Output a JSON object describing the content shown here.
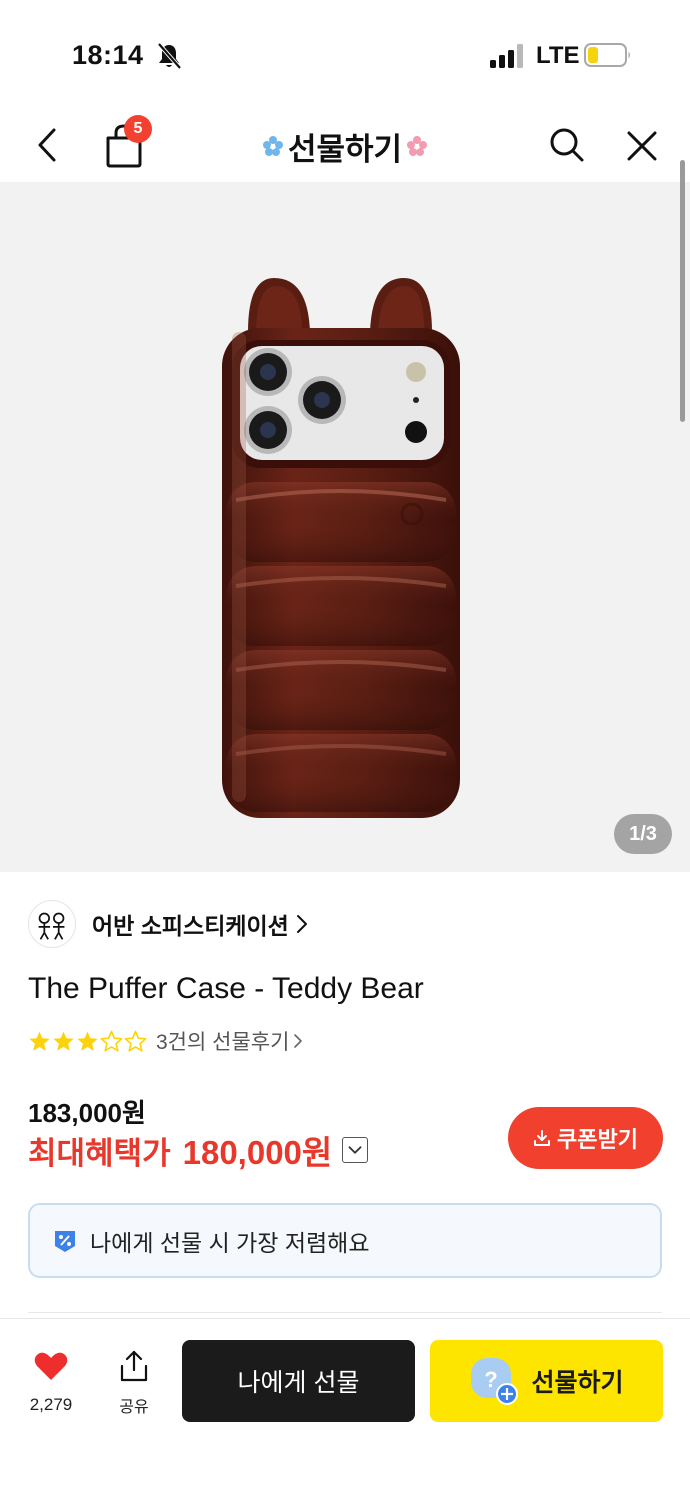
{
  "status_bar": {
    "time": "18:14",
    "network": "LTE"
  },
  "nav": {
    "cart_count": "5",
    "title": "선물하기"
  },
  "gallery": {
    "page_indicator": "1/3"
  },
  "product": {
    "brand": "어반 소피스티케이션",
    "title": "The Puffer Case - Teddy Bear",
    "rating_stars": 3,
    "rating_max": 5,
    "review_link": "3건의 선물후기",
    "original_price": "183,000원",
    "benefit_label": "최대혜택가",
    "benefit_price": "180,000원"
  },
  "coupon": {
    "label": "쿠폰받기"
  },
  "notice": {
    "text": "나에게 선물 시 가장 저렴해요"
  },
  "bottom_bar": {
    "like_count": "2,279",
    "share_label": "공유",
    "self_gift_label": "나에게 선물",
    "gift_label": "선물하기"
  },
  "colors": {
    "accent_red": "#f1402d",
    "price_red": "#e8382c",
    "gift_yellow": "#fee500",
    "star_yellow": "#fcd20c",
    "notice_border": "#c7ddf2",
    "case_brown": "#5e1e14"
  }
}
